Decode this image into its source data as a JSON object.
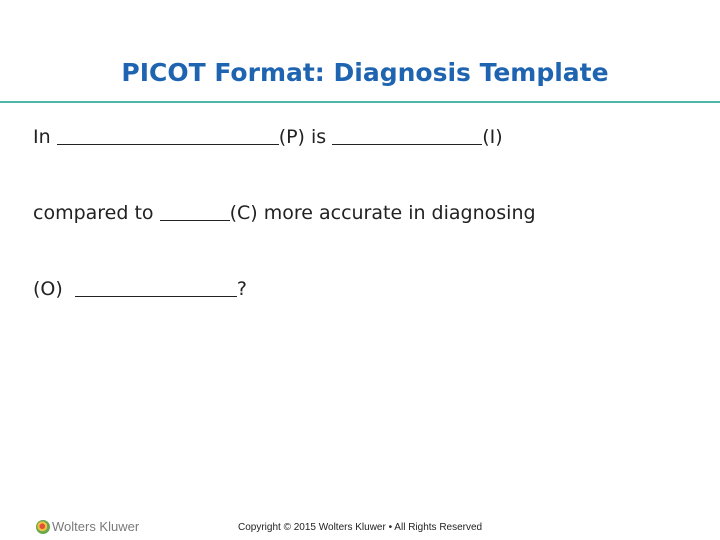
{
  "slide": {
    "title": "PICOT Format: Diagnosis Template",
    "colors": {
      "title": "#1f64b0",
      "divider": "#4db8a8"
    },
    "lines": [
      {
        "parts": [
          "In ",
          "(P) is ",
          "(I)"
        ]
      },
      {
        "parts": [
          "compared to ",
          "(C) more accurate in diagnosing"
        ]
      },
      {
        "parts": [
          "(O)  ",
          "?"
        ]
      }
    ]
  },
  "footer": {
    "logo_text": "Wolters Kluwer",
    "logo_icon": "globe-icon",
    "copyright": "Copyright © 2015 Wolters Kluwer • All Rights Reserved"
  }
}
